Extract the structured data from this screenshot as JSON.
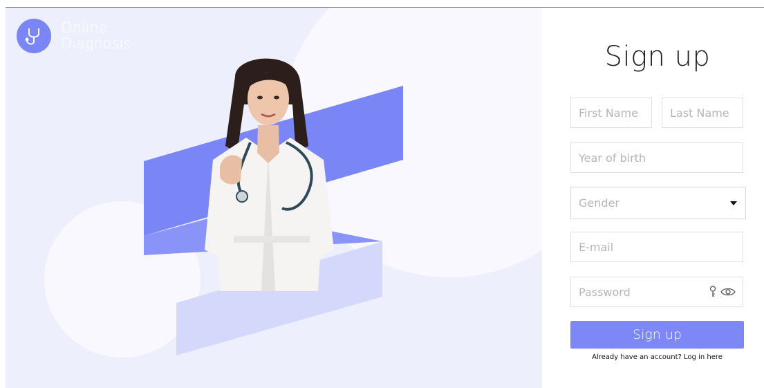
{
  "logo": {
    "line1": "Online",
    "line2": "Diagnosis"
  },
  "form": {
    "title": "Sign up",
    "first_name_placeholder": "First Name",
    "last_name_placeholder": "Last Name",
    "year_placeholder": "Year of birth",
    "gender_label": "Gender",
    "email_placeholder": "E-mail",
    "password_placeholder": "Password",
    "submit_label": "Sign up",
    "login_prompt": "Already have an account?",
    "login_link": "Log in here"
  },
  "colors": {
    "accent": "#7d87f6",
    "hero_bg": "#eeeffd",
    "shape_dark": "#7b86f6",
    "shape_light": "#d4d9fb"
  },
  "icons": [
    "stethoscope-icon",
    "key-icon",
    "eye-icon",
    "chevron-down-icon"
  ]
}
